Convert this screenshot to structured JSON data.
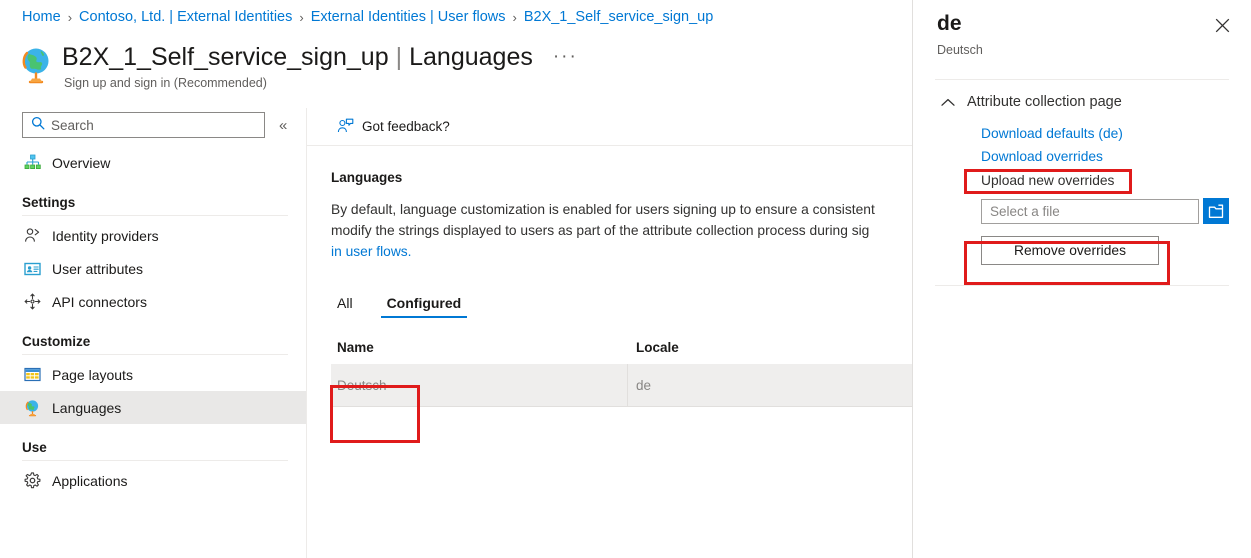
{
  "breadcrumb": {
    "items": [
      {
        "label": "Home"
      },
      {
        "label": "Contoso, Ltd. | External Identities"
      },
      {
        "label": "External Identities | User flows"
      },
      {
        "label": "B2X_1_Self_service_sign_up"
      }
    ],
    "separator": "›"
  },
  "header": {
    "title_main": "B2X_1_Self_service_sign_up",
    "title_separator": "|",
    "title_section": "Languages",
    "subtitle": "Sign up and sign in (Recommended)",
    "more_menu": "···",
    "icon": "globe-icon"
  },
  "sidebar": {
    "search": {
      "placeholder": "Search",
      "value": "",
      "icon": "search-icon"
    },
    "collapse": {
      "label": "«",
      "name": "collapse-sidebar-button"
    },
    "top_items": [
      {
        "label": "Overview",
        "icon": "overview-icon",
        "selected": false
      }
    ],
    "groups": [
      {
        "label": "Settings",
        "items": [
          {
            "label": "Identity providers",
            "icon": "identity-providers-icon",
            "selected": false
          },
          {
            "label": "User attributes",
            "icon": "user-attributes-icon",
            "selected": false
          },
          {
            "label": "API connectors",
            "icon": "api-connectors-icon",
            "selected": false
          }
        ]
      },
      {
        "label": "Customize",
        "items": [
          {
            "label": "Page layouts",
            "icon": "page-layouts-icon",
            "selected": false
          },
          {
            "label": "Languages",
            "icon": "languages-icon",
            "selected": true
          }
        ]
      },
      {
        "label": "Use",
        "items": [
          {
            "label": "Applications",
            "icon": "applications-icon",
            "selected": false
          }
        ]
      }
    ]
  },
  "main": {
    "command_bar": {
      "feedback_label": "Got feedback?",
      "feedback_icon": "feedback-person-icon"
    },
    "section_title": "Languages",
    "description_lines": [
      "By default, language customization is enabled for users signing up to ensure a consistent",
      "modify the strings displayed to users as part of the attribute collection process during sig"
    ],
    "description_link": "in user flows.",
    "tabs": [
      {
        "label": "All",
        "active": false
      },
      {
        "label": "Configured",
        "active": true
      }
    ],
    "table": {
      "columns": [
        "Name",
        "Locale"
      ],
      "rows": [
        {
          "name": "Deutsch",
          "locale": "de"
        }
      ]
    }
  },
  "panel": {
    "title": "de",
    "subtitle": "Deutsch",
    "close_icon": "close-icon",
    "accordion": {
      "label": "Attribute collection page",
      "chevron_icon": "chevron-up-icon",
      "expanded": true
    },
    "download_defaults_label": "Download defaults (de)",
    "download_overrides_label": "Download overrides",
    "upload_label": "Upload new overrides",
    "file_input": {
      "placeholder": "Select a file",
      "value": ""
    },
    "browse_icon": "folder-open-icon",
    "remove_button_label": "Remove overrides"
  },
  "colors": {
    "accent": "#0078d4",
    "annotation": "#e01b1b",
    "row_background": "#efeeed",
    "selected_nav": "#e9e8e7"
  }
}
